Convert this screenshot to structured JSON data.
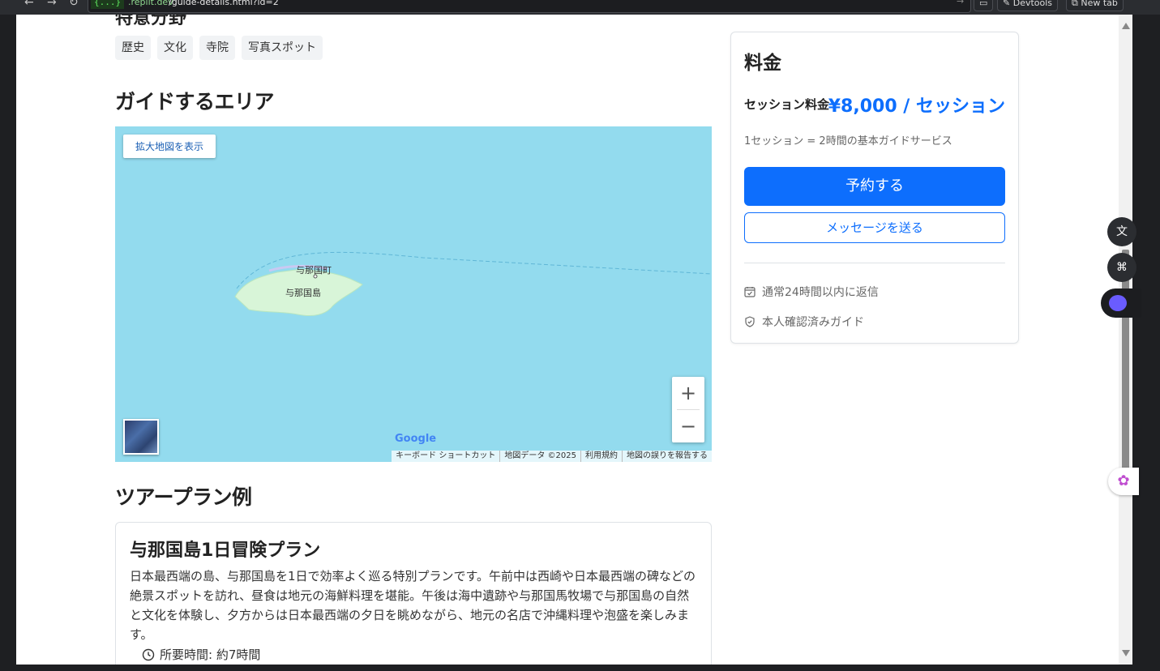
{
  "browser": {
    "domain_chip": "{...}",
    "domain_rest": ".replit.dev",
    "url_path": "/guide-details.html?id=2",
    "devtools_label": "Devtools",
    "newtab_label": "New tab"
  },
  "specialties": {
    "heading": "特意分野",
    "tags": [
      "歴史",
      "文化",
      "寺院",
      "写真スポット"
    ]
  },
  "area": {
    "heading": "ガイドするエリア",
    "map": {
      "enlarge_label": "拡大地図を表示",
      "town_label": "与那国町",
      "island_label": "与那国島",
      "zoom_in": "+",
      "zoom_out": "−",
      "google_logo": "Google",
      "attributions": [
        "キーボード ショートカット",
        "地図データ ©2025",
        "利用規約",
        "地図の誤りを報告する"
      ]
    }
  },
  "plans": {
    "heading": "ツアープラン例",
    "items": [
      {
        "title": "与那国島1日冒険プラン",
        "description": "日本最西端の島、与那国島を1日で効率よく巡る特別プランです。午前中は西崎や日本最西端の碑などの絶景スポットを訪れ、昼食は地元の海鮮料理を堪能。午後は海中遺跡や与那国馬牧場で与那国島の自然と文化を体験し、夕方からは日本最西端の夕日を眺めながら、地元の名店で沖縄料理や泡盛を楽しみます。",
        "duration": "所要時間: 約7時間"
      }
    ]
  },
  "pricing": {
    "title": "料金",
    "session_label": "セッション料金",
    "price": "¥8,000 / セッション",
    "note": "1セッション = 2時間の基本ガイドサービス",
    "book_button": "予約する",
    "message_button": "メッセージを送る",
    "features": [
      "通常24時間以内に返信",
      "本人確認済みガイド"
    ]
  },
  "colors": {
    "primary": "#0d6efd",
    "map_water": "#93dbee",
    "map_land": "#d8f5d8"
  }
}
